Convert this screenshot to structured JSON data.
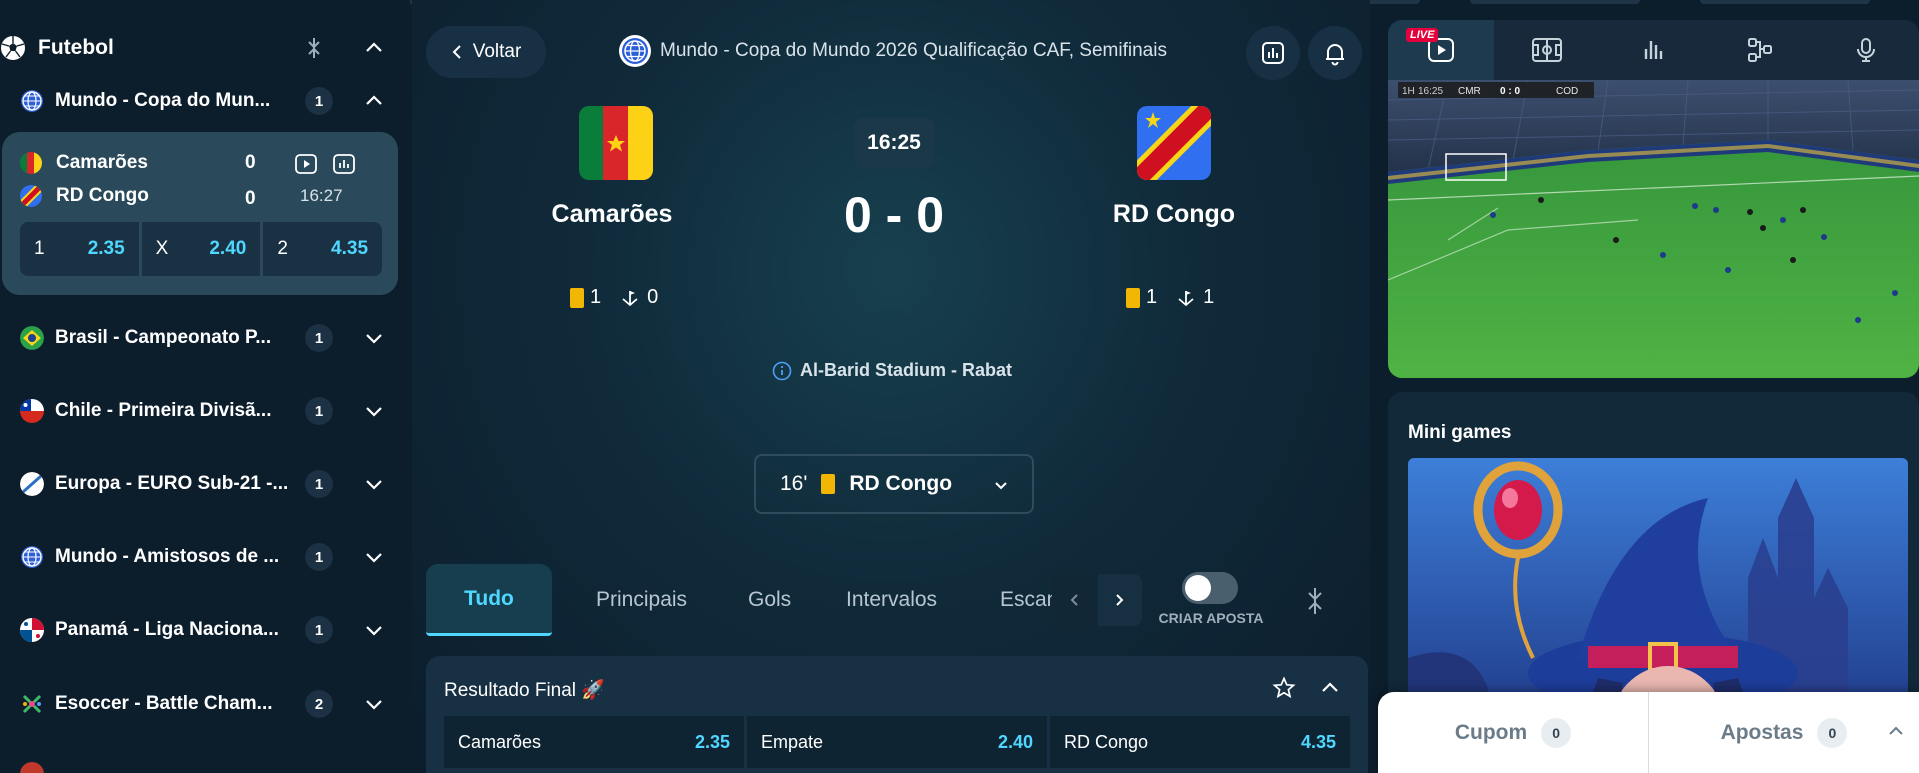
{
  "sidebar": {
    "sport_title": "Futebol",
    "leagues": [
      {
        "name": "Mundo - Copa do Mun...",
        "count": "1",
        "expanded": true,
        "flag": "globe"
      },
      {
        "name": "Brasil - Campeonato P...",
        "count": "1",
        "flag": "brazil"
      },
      {
        "name": "Chile - Primeira Divisã...",
        "count": "1",
        "flag": "chile"
      },
      {
        "name": "Europa - EURO Sub-21 -...",
        "count": "1",
        "flag": "europe"
      },
      {
        "name": "Mundo - Amistosos de ...",
        "count": "1",
        "flag": "globe"
      },
      {
        "name": "Panamá - Liga Naciona...",
        "count": "1",
        "flag": "panama"
      },
      {
        "name": "Esoccer - Battle Cham...",
        "count": "2",
        "flag": "esoccer"
      }
    ],
    "match": {
      "home": "Camarões",
      "away": "RD Congo",
      "home_score": "0",
      "away_score": "0",
      "time": "16:27",
      "odds": [
        {
          "label": "1",
          "value": "2.35"
        },
        {
          "label": "X",
          "value": "2.40"
        },
        {
          "label": "2",
          "value": "4.35"
        }
      ]
    }
  },
  "header": {
    "back_label": "Voltar",
    "competition": "Mundo - Copa do Mundo 2026 Qualificação CAF, Semifinais"
  },
  "scoreboard": {
    "home_name": "Camarões",
    "away_name": "RD Congo",
    "clock": "16:25",
    "score": "0 - 0",
    "home_cards": "1",
    "home_corners": "0",
    "away_cards": "1",
    "away_corners": "1",
    "venue": "Al-Barid Stadium - Rabat"
  },
  "event_select": {
    "minute": "16'",
    "team": "RD Congo"
  },
  "tabs": {
    "items": [
      "Tudo",
      "Principais",
      "Gols",
      "Intervalos",
      "Escan"
    ],
    "toggle_label": "CRIAR APOSTA"
  },
  "market": {
    "title": "Resultado Final 🚀",
    "outcomes": [
      {
        "label": "Camarões",
        "value": "2.35"
      },
      {
        "label": "Empate",
        "value": "2.40"
      },
      {
        "label": "RD Congo",
        "value": "4.35"
      }
    ]
  },
  "right_panel": {
    "live_badge": "LIVE",
    "scorebug": {
      "period": "1H",
      "clock": "16:25",
      "home": "CMR",
      "score": "0 : 0",
      "away": "COD"
    },
    "mini_games_title": "Mini games"
  },
  "betslip": {
    "coupon_label": "Cupom",
    "coupon_count": "0",
    "bets_label": "Apostas",
    "bets_count": "0"
  },
  "colors": {
    "accent": "#4fd7ff",
    "background": "#0c1d2c",
    "card_yellow": "#f2b705",
    "live_red": "#e4003a"
  }
}
